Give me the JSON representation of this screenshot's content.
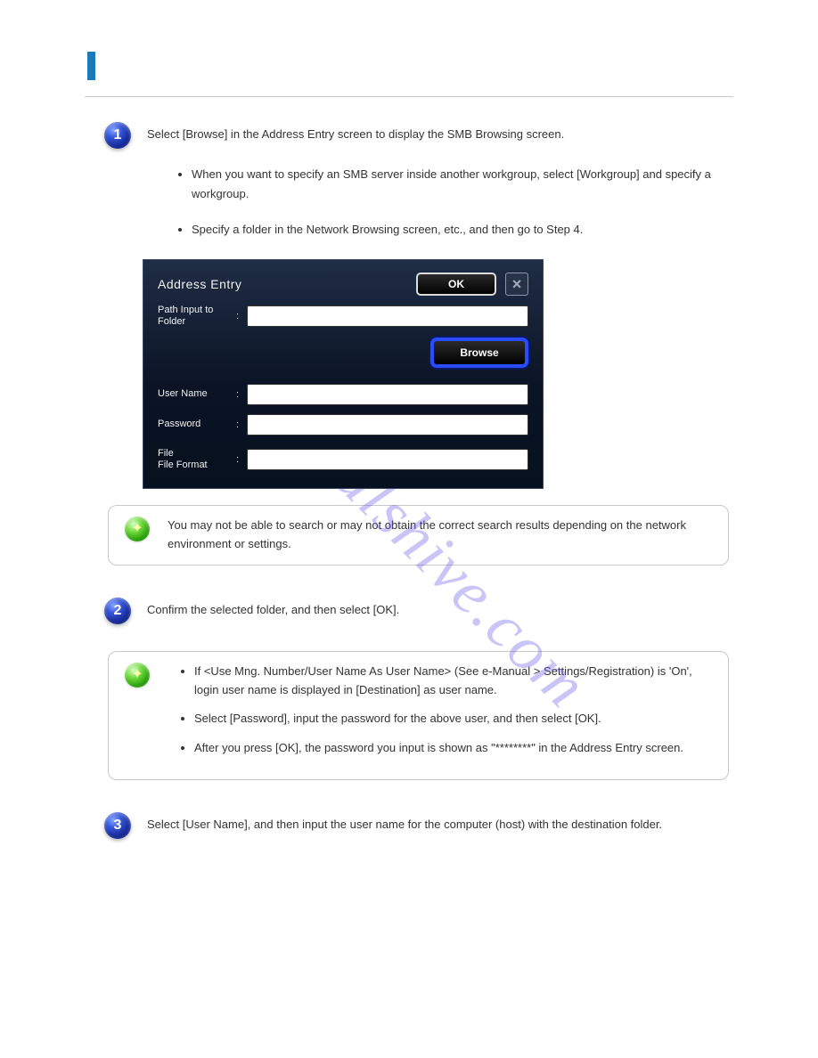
{
  "steps": {
    "s1": {
      "num": "1",
      "text": "Select [Browse] in the Address Entry screen to display the SMB Browsing screen.",
      "bullets": [
        "When you want to specify an SMB server inside another workgroup, select [Workgroup] and specify a workgroup.",
        "Specify a folder in the Network Browsing screen, etc., and then go to Step 4."
      ]
    },
    "s2": {
      "num": "2",
      "text": "Confirm the selected folder, and then select [OK]."
    },
    "s3": {
      "num": "3",
      "text": "Select [User Name], and then input the user name for the computer (host) with the destination folder."
    }
  },
  "dialog": {
    "title": "Address Entry",
    "ok": "OK",
    "close": "×",
    "path_label": "Path Input to Folder",
    "browse": "Browse",
    "username_label": "User Name",
    "password_label": "Password",
    "file_label": "File\nFile Format",
    "colon": ":"
  },
  "note1": {
    "text": "You may not be able to search or may not obtain the correct search results depending on the network environment or settings."
  },
  "note2": {
    "items": [
      "If <Use Mng. Number/User Name As User Name> (See e-Manual > Settings/Registration) is 'On', login user name is displayed in [Destination] as user name.",
      "Select [Password], input the password for the above user, and then select [OK].",
      "After you press [OK], the password you input is shown as \"********\" in the Address Entry screen."
    ]
  },
  "watermark": "manualshive.com"
}
